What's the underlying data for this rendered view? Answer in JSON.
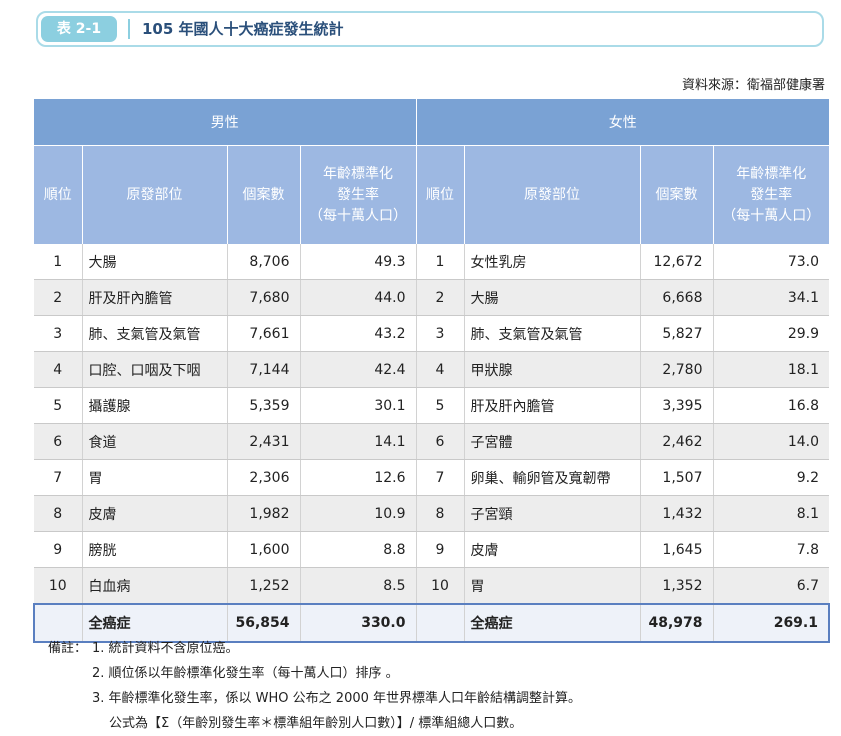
{
  "header": {
    "tag": "表 2-1",
    "title": "105 年國人十大癌症發生統計"
  },
  "source": "資料來源：衛福部健康署",
  "table": {
    "groups": [
      "男性",
      "女性"
    ],
    "columns": {
      "rank": "順位",
      "site": "原發部位",
      "cases": "個案數",
      "rate_lines": [
        "年齡標準化",
        "發生率",
        "（每十萬人口）"
      ]
    },
    "rows": [
      {
        "m_rank": "1",
        "m_site": "大腸",
        "m_cases": "8,706",
        "m_rate": "49.3",
        "f_rank": "1",
        "f_site": "女性乳房",
        "f_cases": "12,672",
        "f_rate": "73.0"
      },
      {
        "m_rank": "2",
        "m_site": "肝及肝內膽管",
        "m_cases": "7,680",
        "m_rate": "44.0",
        "f_rank": "2",
        "f_site": "大腸",
        "f_cases": "6,668",
        "f_rate": "34.1"
      },
      {
        "m_rank": "3",
        "m_site": "肺、支氣管及氣管",
        "m_cases": "7,661",
        "m_rate": "43.2",
        "f_rank": "3",
        "f_site": "肺、支氣管及氣管",
        "f_cases": "5,827",
        "f_rate": "29.9"
      },
      {
        "m_rank": "4",
        "m_site": "口腔、口咽及下咽",
        "m_cases": "7,144",
        "m_rate": "42.4",
        "f_rank": "4",
        "f_site": "甲狀腺",
        "f_cases": "2,780",
        "f_rate": "18.1"
      },
      {
        "m_rank": "5",
        "m_site": "攝護腺",
        "m_cases": "5,359",
        "m_rate": "30.1",
        "f_rank": "5",
        "f_site": "肝及肝內膽管",
        "f_cases": "3,395",
        "f_rate": "16.8"
      },
      {
        "m_rank": "6",
        "m_site": "食道",
        "m_cases": "2,431",
        "m_rate": "14.1",
        "f_rank": "6",
        "f_site": "子宮體",
        "f_cases": "2,462",
        "f_rate": "14.0"
      },
      {
        "m_rank": "7",
        "m_site": "胃",
        "m_cases": "2,306",
        "m_rate": "12.6",
        "f_rank": "7",
        "f_site": "卵巢、輸卵管及寬韌帶",
        "f_cases": "1,507",
        "f_rate": "9.2"
      },
      {
        "m_rank": "8",
        "m_site": "皮膚",
        "m_cases": "1,982",
        "m_rate": "10.9",
        "f_rank": "8",
        "f_site": "子宮頸",
        "f_cases": "1,432",
        "f_rate": "8.1"
      },
      {
        "m_rank": "9",
        "m_site": "膀胱",
        "m_cases": "1,600",
        "m_rate": "8.8",
        "f_rank": "9",
        "f_site": "皮膚",
        "f_cases": "1,645",
        "f_rate": "7.8"
      },
      {
        "m_rank": "10",
        "m_site": "白血病",
        "m_cases": "1,252",
        "m_rate": "8.5",
        "f_rank": "10",
        "f_site": "胃",
        "f_cases": "1,352",
        "f_rate": "6.7"
      }
    ],
    "total": {
      "m_label": "全癌症",
      "m_cases": "56,854",
      "m_rate": "330.0",
      "f_label": "全癌症",
      "f_cases": "48,978",
      "f_rate": "269.1"
    }
  },
  "notes": {
    "lead": "備註：",
    "items": [
      "1. 統計資料不含原位癌。",
      "2. 順位係以年齡標準化發生率（每十萬人口）排序 。",
      "3. 年齡標準化發生率，係以 WHO 公布之 2000 年世界標準人口年齡結構調整計算。"
    ],
    "formula": "公式為【Σ（年齡別發生率＊標準組年齡別人口數）】/ 標準組總人口數。"
  }
}
